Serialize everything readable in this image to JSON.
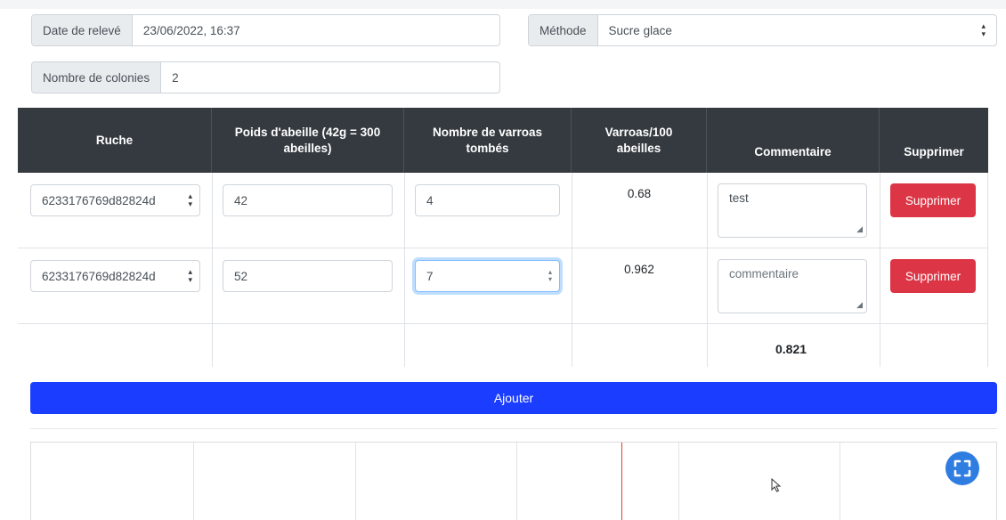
{
  "form": {
    "date_label": "Date de relevé",
    "date_value": "23/06/2022, 16:37",
    "method_label": "Méthode",
    "method_value": "Sucre glace",
    "colonies_label": "Nombre de colonies",
    "colonies_value": "2"
  },
  "table": {
    "headers": [
      "Ruche",
      "Poids d'abeille (42g = 300 abeilles)",
      "Nombre de varroas tombés",
      "Varroas/100 abeilles",
      "Commentaire",
      "Supprimer"
    ],
    "rows": [
      {
        "ruche": "6233176769d82824d",
        "poids": "42",
        "varroas": "4",
        "ratio": "0.68",
        "commentaire": "test",
        "commentaire_placeholder": "",
        "delete_label": "Supprimer"
      },
      {
        "ruche": "6233176769d82824d",
        "poids": "52",
        "varroas": "7",
        "ratio": "0.962",
        "commentaire": "",
        "commentaire_placeholder": "commentaire",
        "delete_label": "Supprimer"
      }
    ],
    "total": "0.821"
  },
  "actions": {
    "add_label": "Ajouter"
  },
  "colors": {
    "header_bg": "#343a40",
    "danger": "#dc3545",
    "primary": "#1a3dff",
    "chart_marker": "#e23b2e",
    "fullscreen_button": "#2f7de1"
  },
  "icons": {
    "select": "chevron-updown-icon",
    "fullscreen": "fullscreen-icon",
    "cursor": "mouse-cursor-icon"
  }
}
